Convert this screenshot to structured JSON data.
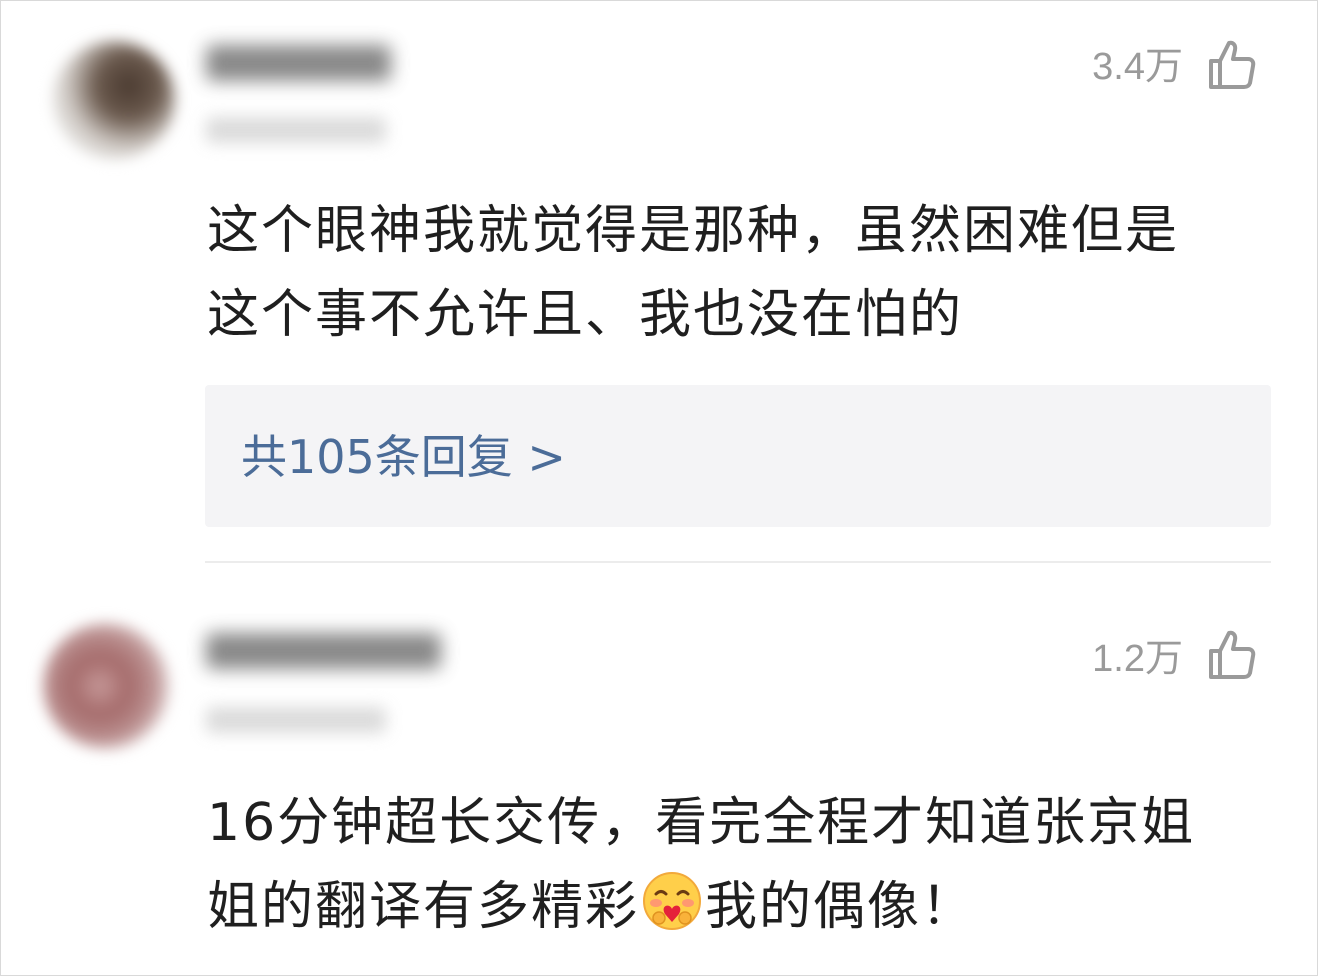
{
  "comments": [
    {
      "likes": "3.4万",
      "text_lines": [
        "这个眼神我就觉得是那种，虽然困难但是",
        "这个事不允许且、我也没在怕的"
      ],
      "replies_label": "共105条回复 >"
    },
    {
      "likes": "1.2万",
      "text_line1": "16分钟超长交传，看完全程才知道张京姐",
      "text_line2_before_emoji": "姐的翻译有多精彩",
      "text_line2_after_emoji": "我的偶像！",
      "emoji": "hugging-face-emoji"
    }
  ],
  "colors": {
    "reply_link": "#4b6c98",
    "reply_box_bg": "#f4f4f6",
    "meta_gray": "#9a9a9a",
    "text": "#1f1f1f"
  },
  "icons": {
    "like": "thumbs-up-outline-icon"
  }
}
